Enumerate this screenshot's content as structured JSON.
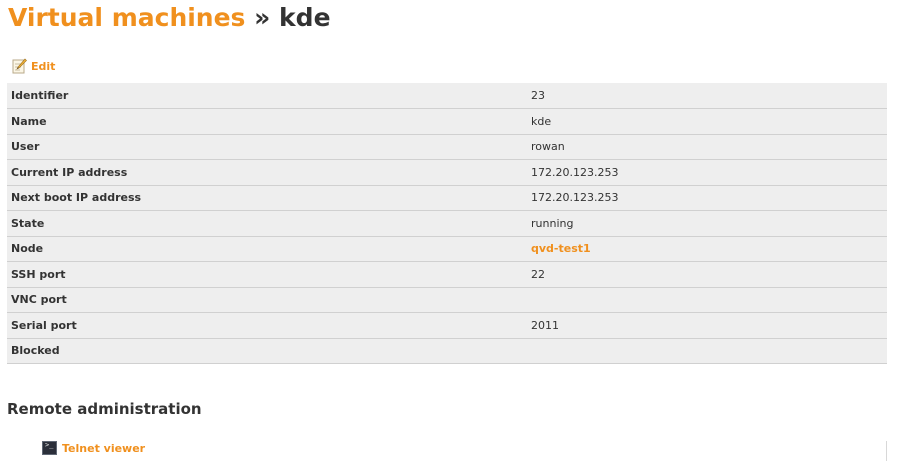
{
  "header": {
    "breadcrumb_link": "Virtual machines",
    "separator": "»",
    "current": "kde"
  },
  "actions": {
    "edit_label": "Edit"
  },
  "details": [
    {
      "label": "Identifier",
      "value": "23"
    },
    {
      "label": "Name",
      "value": "kde"
    },
    {
      "label": "User",
      "value": "rowan"
    },
    {
      "label": "Current IP address",
      "value": "172.20.123.253"
    },
    {
      "label": "Next boot IP address",
      "value": "172.20.123.253"
    },
    {
      "label": "State",
      "value": "running"
    },
    {
      "label": "Node",
      "value": "qvd-test1",
      "is_link": true
    },
    {
      "label": "SSH port",
      "value": "22"
    },
    {
      "label": "VNC port",
      "value": ""
    },
    {
      "label": "Serial port",
      "value": "2011"
    },
    {
      "label": "Blocked",
      "value": ""
    }
  ],
  "remote": {
    "heading": "Remote administration",
    "telnet_label": "Telnet viewer"
  },
  "colors": {
    "accent": "#f0901e",
    "row_alt": "#eeeeee",
    "text": "#333333"
  },
  "icons": {
    "edit": "pencil-paper-icon",
    "telnet": "terminal-icon"
  }
}
